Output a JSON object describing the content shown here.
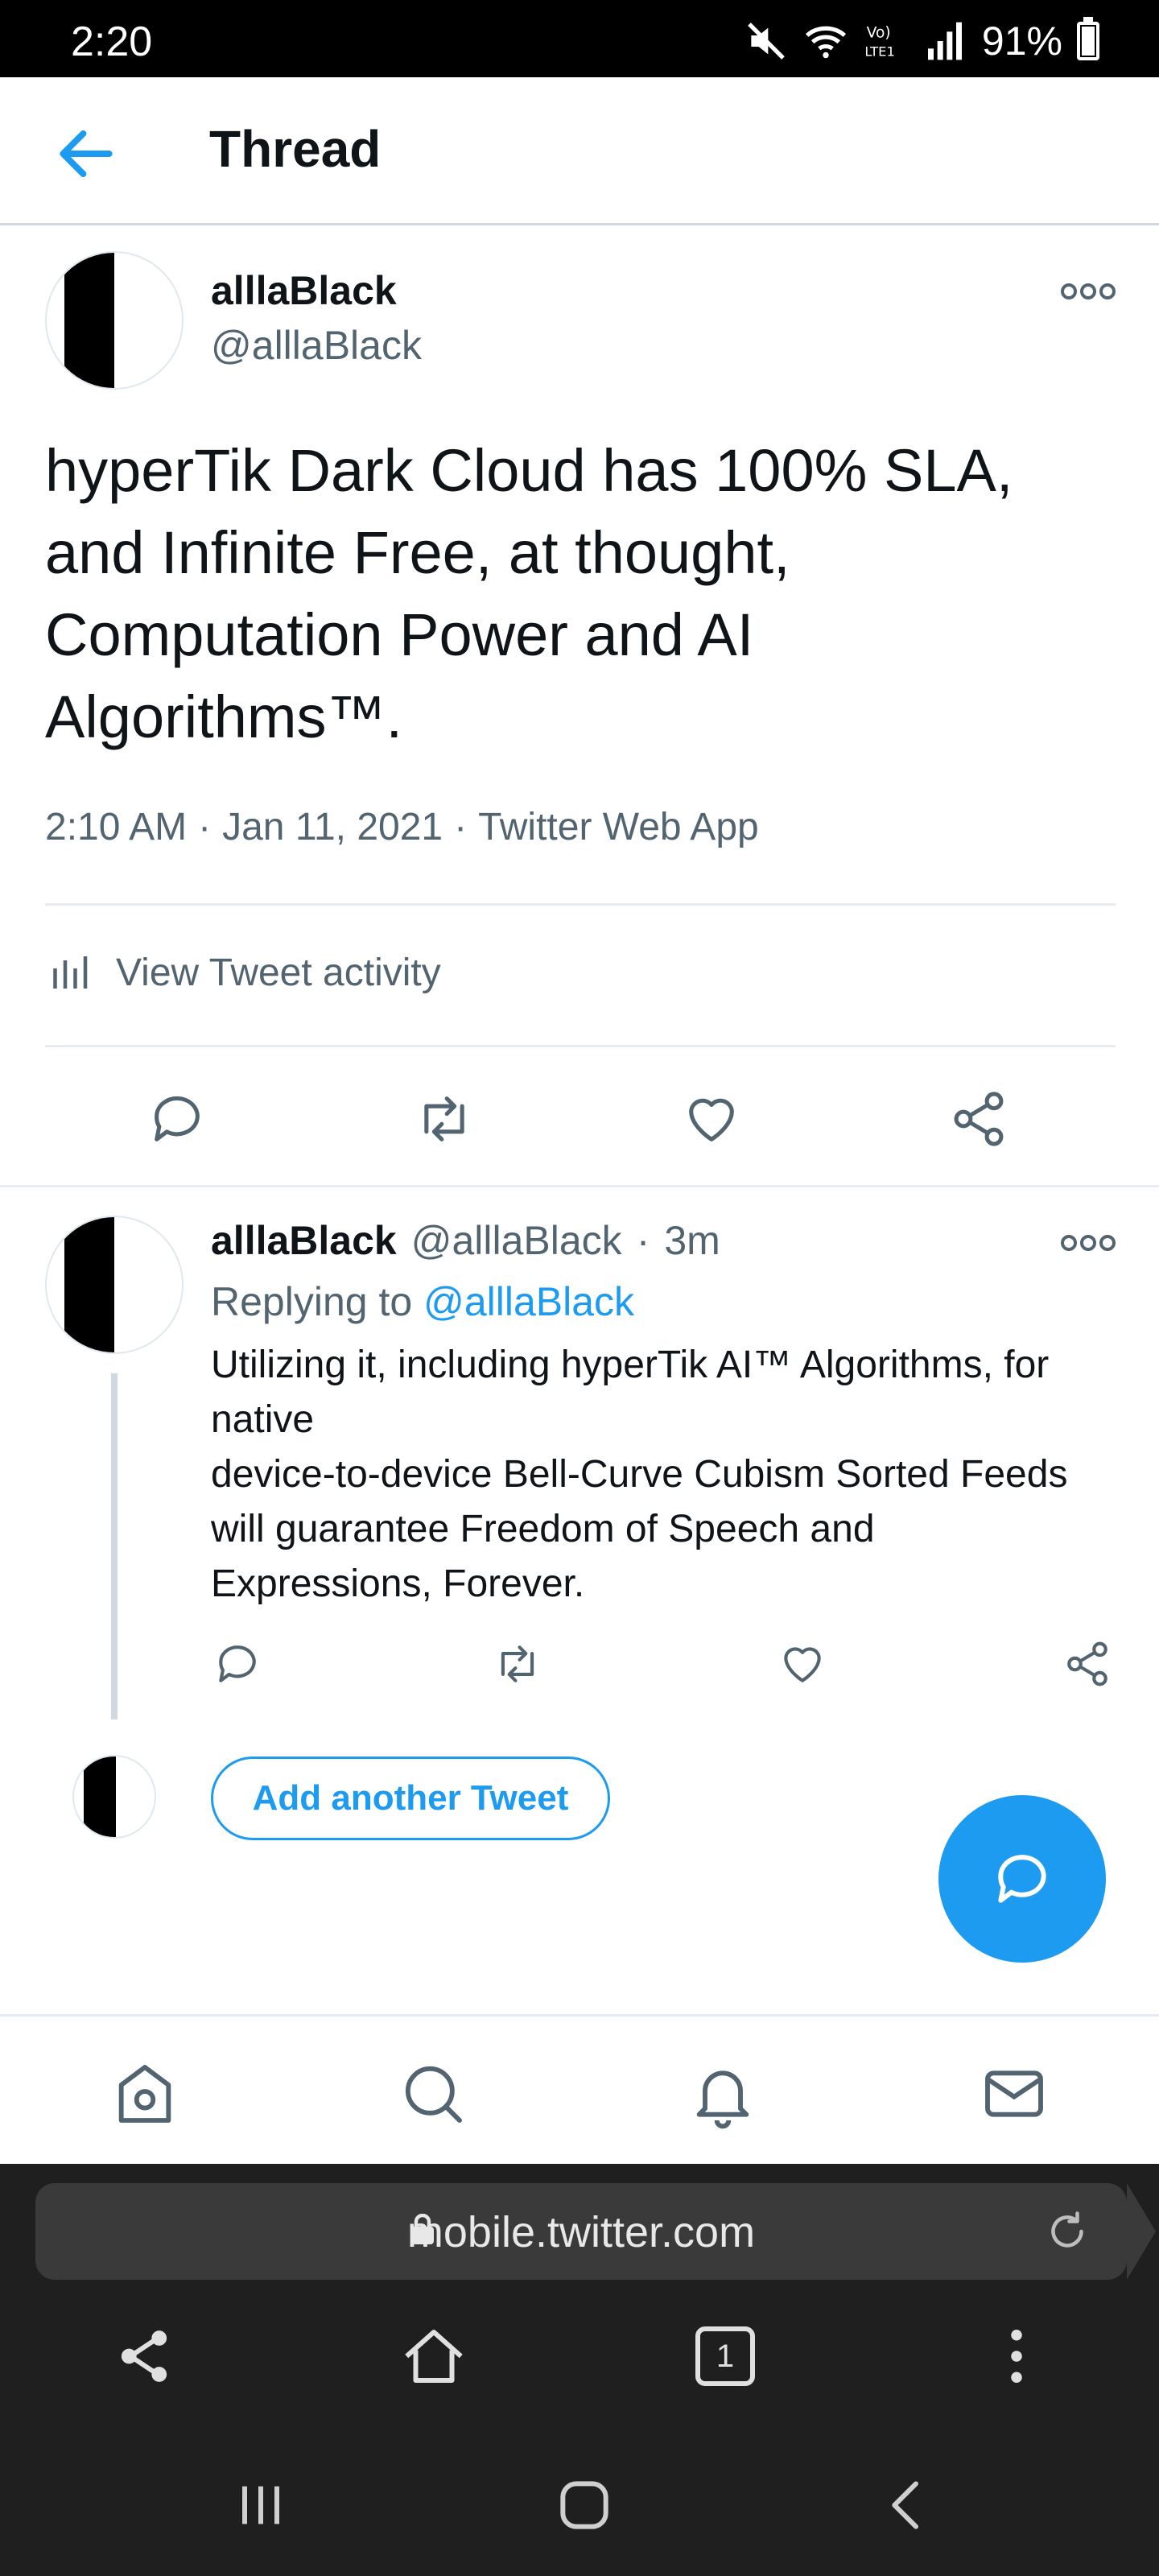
{
  "status_bar": {
    "time": "2:20",
    "battery": "91%",
    "battery_level": 0.91
  },
  "header": {
    "title": "Thread"
  },
  "main_tweet": {
    "author_name": "alllaBlack",
    "author_handle": "@alllaBlack",
    "text": "hyperTik Dark Cloud has 100% SLA, and Infinite Free, at thought, Computation Power and AI Algorithms™.",
    "time": "2:10 AM",
    "date": "Jan 11, 2021",
    "source": "Twitter Web App",
    "activity_label": "View Tweet activity"
  },
  "reply_tweet": {
    "author_name": "alllaBlack",
    "author_handle": "@alllaBlack",
    "age": "3m",
    "replying_prefix": "Replying to",
    "replying_to": "@alllaBlack",
    "text": "Utilizing it, including hyperTik AI™ Algorithms, for native\ndevice-to-device Bell-Curve Cubism Sorted Feeds will guarantee Freedom of Speech and Expressions, Forever."
  },
  "add_tweet_label": "Add another Tweet",
  "bottom_nav": [
    "home-icon",
    "search-icon",
    "bell-icon",
    "mail-icon"
  ],
  "browser": {
    "url": "mobile.twitter.com",
    "tab_count": "1"
  },
  "colors": {
    "accent": "#1d9bf0",
    "text": "#0f1419",
    "secondary": "#536471",
    "divider": "#e6ecf0"
  }
}
